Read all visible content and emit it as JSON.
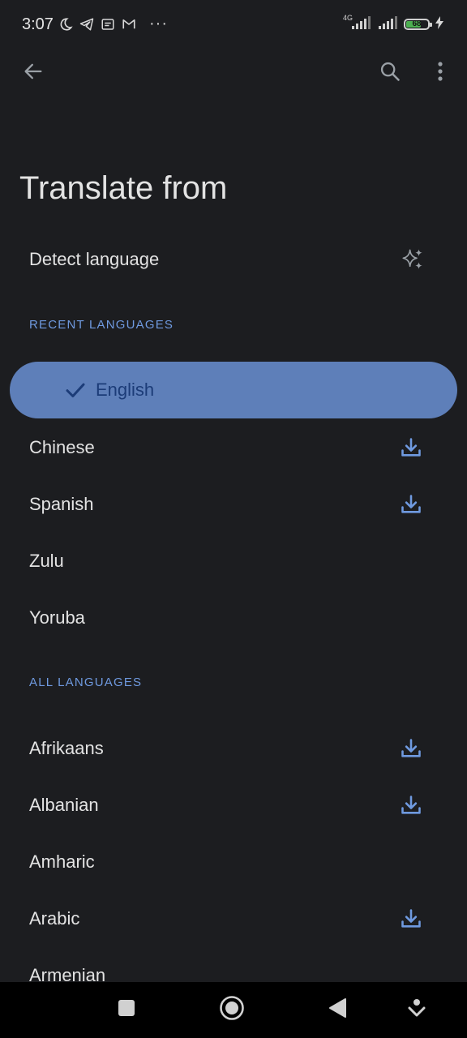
{
  "status_bar": {
    "time": "3:07",
    "more": "···",
    "network": "4G",
    "battery_level": 68,
    "battery_text": "68"
  },
  "page": {
    "title": "Translate from"
  },
  "detect": {
    "label": "Detect language",
    "icon": "sparkle-icon"
  },
  "sections": {
    "recent": "RECENT LANGUAGES",
    "all": "ALL LANGUAGES"
  },
  "recent_languages": [
    {
      "label": "English",
      "selected": true,
      "downloadable": false
    },
    {
      "label": "Chinese",
      "selected": false,
      "downloadable": true
    },
    {
      "label": "Spanish",
      "selected": false,
      "downloadable": true
    },
    {
      "label": "Zulu",
      "selected": false,
      "downloadable": false
    },
    {
      "label": "Yoruba",
      "selected": false,
      "downloadable": false
    }
  ],
  "all_languages": [
    {
      "label": "Afrikaans",
      "downloadable": true
    },
    {
      "label": "Albanian",
      "downloadable": true
    },
    {
      "label": "Amharic",
      "downloadable": false
    },
    {
      "label": "Arabic",
      "downloadable": true
    },
    {
      "label": "Armenian",
      "downloadable": false
    }
  ],
  "colors": {
    "background": "#1c1d20",
    "accent": "#6f9ae0",
    "selected_pill": "#5e7fb9",
    "selected_text": "#1c3c78",
    "text": "#e3e3e3",
    "icon": "#9aa0a6"
  }
}
